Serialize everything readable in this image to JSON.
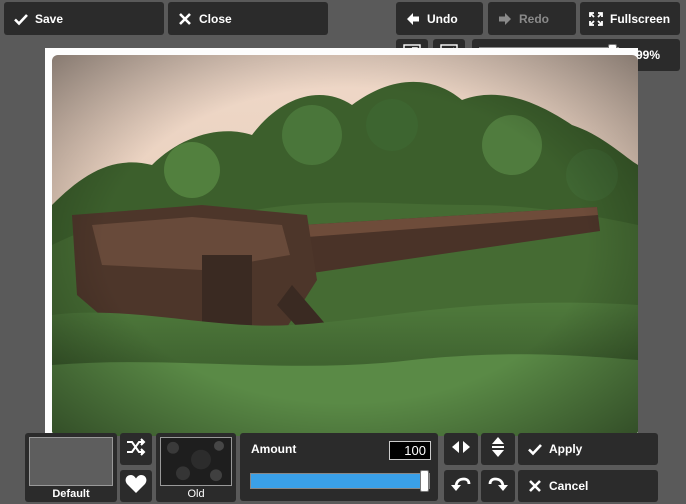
{
  "toolbar": {
    "save_label": "Save",
    "close_label": "Close",
    "undo_label": "Undo",
    "redo_label": "Redo",
    "fullscreen_label": "Fullscreen"
  },
  "zoom": {
    "value_text": "99%",
    "fraction": 0.99
  },
  "effect": {
    "presets": [
      {
        "label": "Default",
        "icon": "blank-preview"
      },
      {
        "label": "Old",
        "icon": "grunge-texture-preview"
      }
    ],
    "amount_label": "Amount",
    "amount_value": "100",
    "amount_fraction": 1.0,
    "apply_label": "Apply",
    "cancel_label": "Cancel"
  },
  "colors": {
    "accent": "#3aa0e8",
    "panel": "#2b2b2b",
    "background": "#5a5a5a"
  }
}
